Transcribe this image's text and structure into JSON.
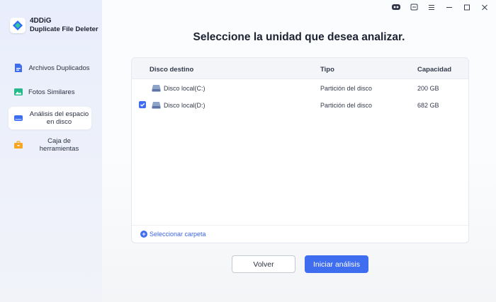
{
  "brand": {
    "name": "4DDiG",
    "product": "Duplicate File Deleter"
  },
  "sidebar": {
    "items": [
      {
        "label": "Archivos Duplicados",
        "icon": "document-icon",
        "active": false
      },
      {
        "label": "Fotos Similares",
        "icon": "photo-icon",
        "active": false
      },
      {
        "label": "Análisis del espacio en disco",
        "icon": "disk-icon",
        "active": true
      },
      {
        "label": "Caja de herramientas",
        "icon": "toolbox-icon",
        "active": false
      }
    ]
  },
  "window": {
    "controls": [
      "assistant-icon",
      "feedback-icon",
      "menu-icon",
      "minimize-icon",
      "maximize-icon",
      "close-icon"
    ]
  },
  "main": {
    "title": "Seleccione la unidad que desea analizar.",
    "columns": {
      "disk": "Disco destino",
      "type": "Tipo",
      "capacity": "Capacidad"
    },
    "rows": [
      {
        "name": "Disco local(C:)",
        "type": "Partición del disco",
        "capacity": "200 GB",
        "checked": false
      },
      {
        "name": "Disco local(D:)",
        "type": "Partición del disco",
        "capacity": "682 GB",
        "checked": true
      }
    ],
    "select_folder": "Seleccionar carpeta",
    "back_button": "Volver",
    "start_button": "Iniciar análisis"
  },
  "colors": {
    "accent": "#3f6df0",
    "sidebar_bg": "#e9eefc"
  }
}
